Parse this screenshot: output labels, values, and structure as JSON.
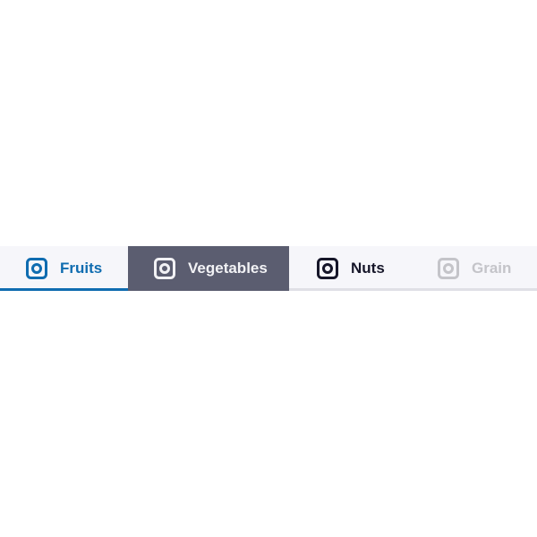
{
  "tabs": [
    {
      "label": "Fruits",
      "icon": "instagram-icon",
      "state": "selected",
      "color": "#0f6cb0"
    },
    {
      "label": "Vegetables",
      "icon": "instagram-icon",
      "state": "hover",
      "color": "#5b5d70"
    },
    {
      "label": "Nuts",
      "icon": "instagram-icon",
      "state": "default",
      "color": "#161629"
    },
    {
      "label": "Grain",
      "icon": "instagram-icon",
      "state": "disabled",
      "color": "#c4c4c9"
    }
  ]
}
